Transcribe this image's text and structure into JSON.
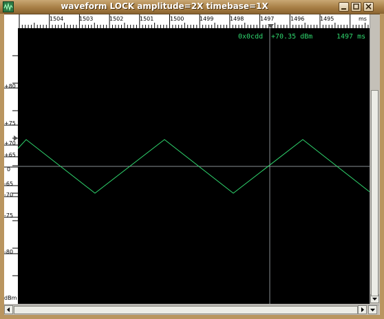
{
  "window": {
    "title": "waveform  LOCK amplitude=2X timebase=1X",
    "app_icon": "waveform-app-icon",
    "controls": [
      "minimize-icon",
      "maximize-icon",
      "close-icon"
    ]
  },
  "top_ruler": {
    "labels": [
      "1504",
      "1503",
      "1502",
      "1501",
      "1500",
      "1499",
      "1498",
      "1497",
      "1496",
      "1495",
      "ms"
    ],
    "marker": "triangle-marker-icon"
  },
  "left_ruler": {
    "labels": [
      "+80",
      "+75",
      "+70",
      "+65",
      "0",
      "-65",
      "-70",
      "-75",
      "-80",
      "dBm"
    ]
  },
  "readout": {
    "address": "0x0cdd",
    "level": "+70.35 dBm",
    "time": "1497 ms"
  },
  "colors": {
    "trace": "#2fd66e",
    "cursor": "#8a8f93",
    "plot_bg": "#000000",
    "titlebar": "#a77e45"
  },
  "trace": {
    "shape": "triangle",
    "peaks_ms": [
      1503.5,
      1500.0,
      1496.5
    ],
    "troughs_ms": [
      1501.7,
      1498.2
    ],
    "peak_level": "+70",
    "trough_level": "-70"
  },
  "cursor": {
    "time_ms": 1497,
    "level": "0"
  }
}
